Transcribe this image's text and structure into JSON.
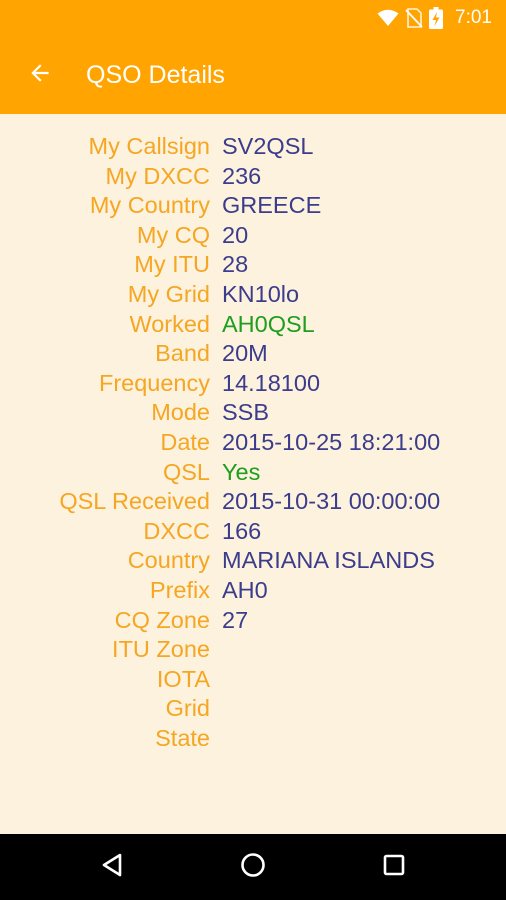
{
  "status_bar": {
    "time": "7:01",
    "icons": [
      "wifi-icon",
      "no-sim-icon",
      "battery-charging-icon"
    ]
  },
  "toolbar": {
    "title": "QSO Details",
    "back_icon": "arrow-back-icon"
  },
  "details": [
    {
      "label": "My Callsign",
      "value": "SV2QSL"
    },
    {
      "label": "My DXCC",
      "value": "236"
    },
    {
      "label": "My Country",
      "value": "GREECE"
    },
    {
      "label": "My CQ",
      "value": "20"
    },
    {
      "label": "My ITU",
      "value": "28"
    },
    {
      "label": "My Grid",
      "value": "KN10lo"
    },
    {
      "label": "Worked",
      "value": "AH0QSL"
    },
    {
      "label": "Band",
      "value": "20M"
    },
    {
      "label": "Frequency",
      "value": "14.18100"
    },
    {
      "label": "Mode",
      "value": "SSB"
    },
    {
      "label": "Date",
      "value": "2015-10-25 18:21:00"
    },
    {
      "label": "QSL",
      "value": "Yes"
    },
    {
      "label": "QSL Received",
      "value": "2015-10-31 00:00:00"
    },
    {
      "label": "DXCC",
      "value": "166"
    },
    {
      "label": "Country",
      "value": "MARIANA ISLANDS"
    },
    {
      "label": "Prefix",
      "value": "AH0"
    },
    {
      "label": "CQ Zone",
      "value": "27"
    },
    {
      "label": "ITU Zone",
      "value": ""
    },
    {
      "label": "IOTA",
      "value": ""
    },
    {
      "label": "Grid",
      "value": ""
    },
    {
      "label": "State",
      "value": ""
    }
  ],
  "nav_bar": {
    "icons": [
      "back-triangle-icon",
      "home-circle-icon",
      "recents-square-icon"
    ]
  },
  "colors": {
    "accent": "#ffa400",
    "background": "#fdf2dd",
    "label": "#f5a623",
    "value": "#3b3d8c",
    "highlight": "#1e9e1e"
  }
}
